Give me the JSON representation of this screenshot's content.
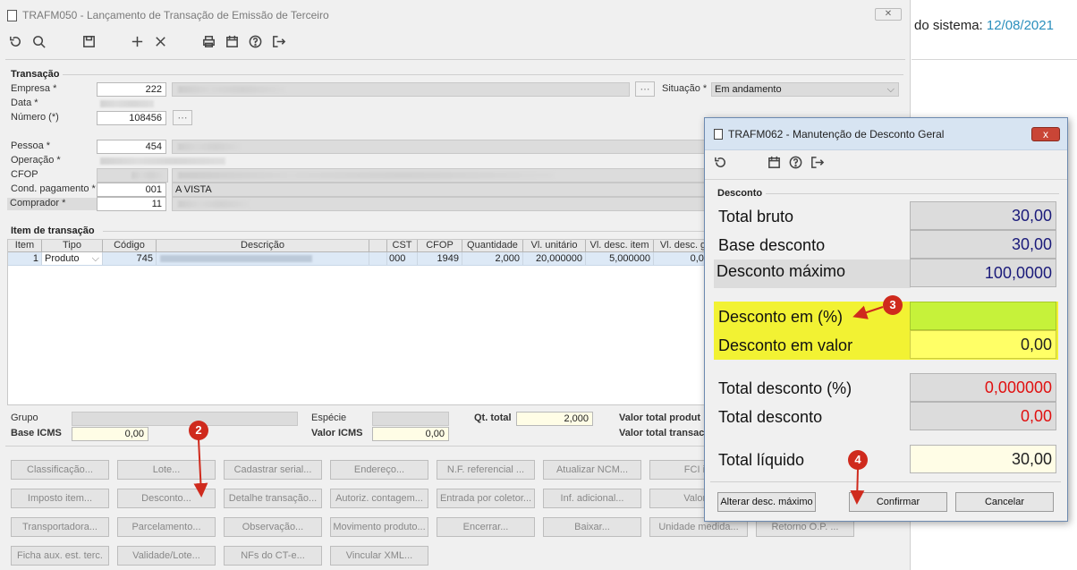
{
  "main": {
    "title": "TRAFM050 - Lançamento de Transação de Emissão de Terceiro",
    "transacao_title": "Transação",
    "empresa_label": "Empresa *",
    "empresa_value": "222",
    "situacao_label": "Situação *",
    "situacao_value": "Em andamento",
    "data_label": "Data *",
    "numero_label": "Número (*)",
    "numero_value": "108456",
    "pessoa_label": "Pessoa *",
    "pessoa_value": "454",
    "operacao_label": "Operação *",
    "cfop_label": "CFOP",
    "condpag_label": "Cond. pagamento *",
    "condpag_value": "001",
    "condpag_desc": "A VISTA",
    "comprador_label": "Comprador *",
    "comprador_value": "11",
    "item_title": "Item de transação",
    "columns": [
      "Item",
      "Tipo",
      "Código",
      "Descrição",
      "",
      "CST",
      "CFOP",
      "Quantidade",
      "Vl. unitário",
      "Vl. desc. item",
      "Vl. desc. g"
    ],
    "row": {
      "item": "1",
      "tipo": "Produto",
      "codigo": "745",
      "cst": "000",
      "cfop": "1949",
      "quantidade": "2,000",
      "unitario": "20,000000",
      "desc_item": "5,000000",
      "desc_g": "0,00"
    },
    "grupo_label": "Grupo",
    "especie_label": "Espécie",
    "qt_total_label": "Qt. total",
    "qt_total_value": "2,000",
    "valor_produto_label": "Valor total produt",
    "base_icms_label": "Base ICMS",
    "base_icms_value": "0,00",
    "valor_icms_label": "Valor ICMS",
    "valor_icms_value": "0,00",
    "valor_transacao_label": "Valor total transac",
    "buttons": [
      [
        "Classificação...",
        "Lote...",
        "Cadastrar serial...",
        "Endereço...",
        "N.F. referencial ...",
        "Atualizar NCM...",
        "FCI ite"
      ],
      [
        "Imposto item...",
        "Desconto...",
        "Detalhe transação...",
        "Autoriz. contagem...",
        "Entrada por coletor...",
        "Inf. adicional...",
        "Valor it"
      ],
      [
        "Transportadora...",
        "Parcelamento...",
        "Observação...",
        "Movimento produto...",
        "Encerrar...",
        "Baixar...",
        "Unidade medida...",
        "Retorno O.P. ..."
      ],
      [
        "Ficha aux. est. terc.",
        "Validade/Lote...",
        "NFs do CT-e...",
        "Vincular XML..."
      ]
    ]
  },
  "side": {
    "label": "do sistema:",
    "date": "12/08/2021"
  },
  "dialog": {
    "title": "TRAFM062 - Manutenção de Desconto Geral",
    "close": "x",
    "group": "Desconto",
    "total_bruto_label": "Total bruto",
    "total_bruto_value": "30,00",
    "base_desconto_label": "Base desconto",
    "base_desconto_value": "30,00",
    "desc_max_label": "Desconto máximo",
    "desc_max_value": "100,0000",
    "desc_pct_label": "Desconto em (%)",
    "desc_pct_value": "",
    "desc_valor_label": "Desconto em valor",
    "desc_valor_value": "0,00",
    "total_desc_pct_label": "Total desconto (%)",
    "total_desc_pct_value": "0,000000",
    "total_desc_label": "Total desconto",
    "total_desc_value": "0,00",
    "total_liq_label": "Total líquido",
    "total_liq_value": "30,00",
    "alterar_label": "Alterar desc. máximo",
    "confirmar_label": "Confirmar",
    "cancelar_label": "Cancelar"
  },
  "badges": [
    "2",
    "3",
    "4"
  ],
  "colors": {
    "badge": "#cf2a1d",
    "highlight_yellow": "#f2f233",
    "field_green": "#c6f23a",
    "field_yellow": "#ffff66",
    "value_blue": "#1a1a7a",
    "value_red": "#e01010"
  }
}
